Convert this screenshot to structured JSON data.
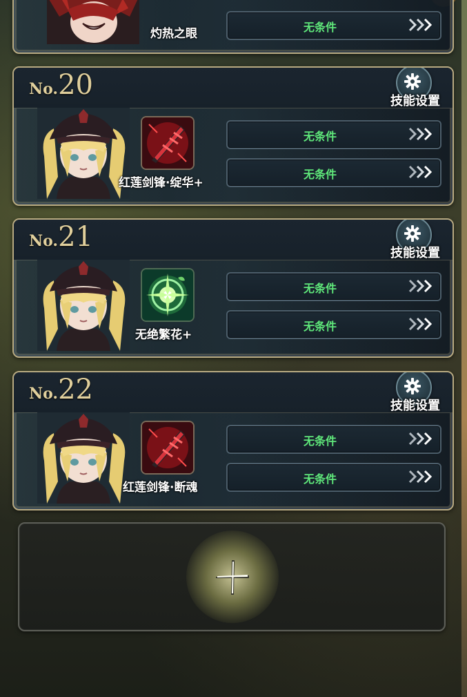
{
  "top_partial": {
    "skill_name": "灼热之眼",
    "condition": "无条件"
  },
  "cards": [
    {
      "no_prefix": "No.",
      "no_number": "20",
      "skill_setting_label": "技能设置",
      "skill_name": "红莲剑锋·绽华+",
      "skill_icon": "crimson-sword-icon",
      "conditions": [
        "无条件",
        "无条件"
      ]
    },
    {
      "no_prefix": "No.",
      "no_number": "21",
      "skill_setting_label": "技能设置",
      "skill_name": "无绝繁花+",
      "skill_icon": "green-flower-orb-icon",
      "conditions": [
        "无条件",
        "无条件"
      ]
    },
    {
      "no_prefix": "No.",
      "no_number": "22",
      "skill_setting_label": "技能设置",
      "skill_name": "红莲剑锋·断魂",
      "skill_icon": "crimson-sword-icon",
      "conditions": [
        "无条件",
        "无条件"
      ]
    }
  ],
  "add_button": {
    "icon": "plus-icon"
  },
  "colors": {
    "condition_text": "#5fe77a",
    "card_border": "#b9ab82",
    "number_gold": "#e0cf9c"
  }
}
